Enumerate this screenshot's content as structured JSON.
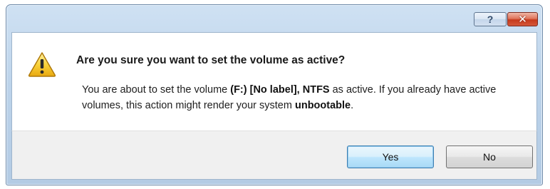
{
  "titlebar": {
    "help_label": "?",
    "close_label": "✕"
  },
  "dialog": {
    "heading": "Are you sure you want to set the volume as active?",
    "body": {
      "part1": "You are about to set the volume ",
      "volume": "(F:) [No label], NTFS",
      "part2": " as active. If you already have active volumes, this action might render your system ",
      "emphasis": "unbootable",
      "part3": "."
    },
    "icon": "warning-icon"
  },
  "buttons": {
    "yes_label": "Yes",
    "no_label": "No"
  },
  "colors": {
    "accent": "#3c7fb1",
    "close": "#c63a1c",
    "warning": "#f5c518"
  }
}
